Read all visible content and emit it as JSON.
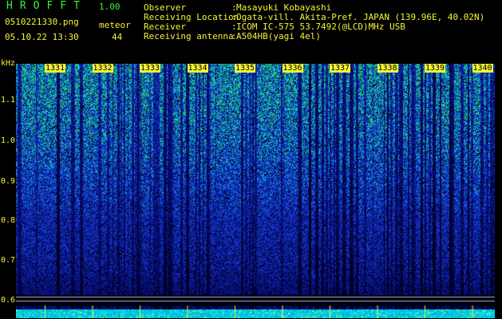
{
  "header": {
    "app_title": "HROFFT",
    "app_version": "1.00",
    "file_name": "0510221330.png",
    "timestamp": "05.10.22 13:30",
    "meteor_label": "meteor",
    "meteor_count": "44"
  },
  "info": {
    "observer_label": "Observer",
    "observer_value": "Masayuki Kobayashi",
    "location_label": "Receiving Location",
    "location_value": "Ogata-vill. Akita-Pref. JAPAN (139.96E, 40.02N)",
    "receiver_label": "Receiver",
    "receiver_value": "ICOM IC-575 53.7492(@LCD)MHz USB",
    "antenna_label": "Receiving antenna",
    "antenna_value": "A504HB(yagi 4el)"
  },
  "axis": {
    "unit": "kHz",
    "freq_ticks": [
      "1.1",
      "1.0",
      "0.9",
      "0.8",
      "0.7",
      "0.6"
    ],
    "time_ticks": [
      "1331",
      "1332",
      "1333",
      "1334",
      "1335",
      "1336",
      "1337",
      "1338",
      "1339",
      "1340"
    ]
  },
  "colors": {
    "text_yellow": "#f4f436",
    "title_green": "#3cf03c",
    "background": "#000000",
    "spectrum_blue": "#1a2fd0",
    "spectrum_cyan": "#3fd0ff",
    "spectrum_green": "#40ff60"
  }
}
